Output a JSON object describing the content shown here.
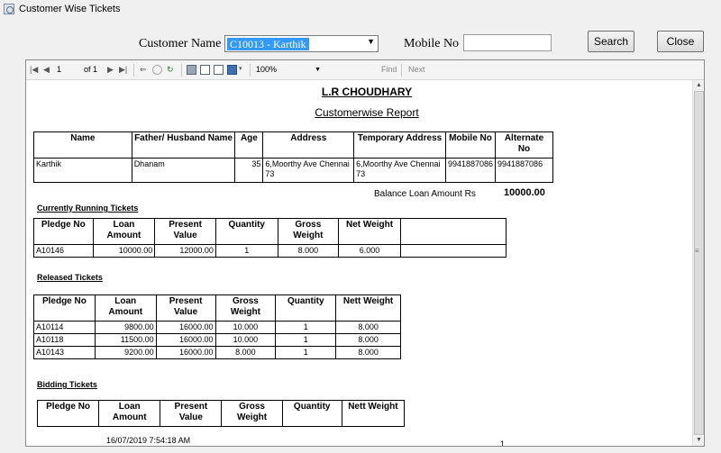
{
  "window": {
    "title": "Customer Wise Tickets"
  },
  "form": {
    "customer_name_label": "Customer Name",
    "customer_selected": "C10013  -  Karthik",
    "mobile_label": "Mobile No",
    "mobile_value": "",
    "search_label": "Search",
    "close_label": "Close"
  },
  "toolbar": {
    "page_current": "1",
    "page_of": "of 1",
    "zoom": "100%",
    "find_label": "Find",
    "next_label": "Next"
  },
  "report": {
    "company": "L.R CHOUDHARY",
    "subtitle": "Customerwise Report",
    "customer_table": {
      "headers": [
        "Name",
        "Father/ Husband Name",
        "Age",
        "Address",
        "Temporary Address",
        "Mobile No",
        "Alternate No"
      ],
      "row": [
        "Karthik",
        "Dhanam",
        "35",
        "6,Moorthy Ave Chennai 73",
        "6,Moorthy Ave Chennai 73",
        "9941887086",
        "9941887086"
      ]
    },
    "balance_label": "Balance Loan Amount Rs",
    "balance_value": "10000.00",
    "running": {
      "title": "Currently Running Tickets",
      "headers": [
        "Pledge No",
        "Loan Amount",
        "Present Value",
        "Quantity",
        "Gross Weight",
        "Net Weight",
        ""
      ],
      "rows": [
        [
          "A10146",
          "10000.00",
          "12000.00",
          "1",
          "8.000",
          "6.000",
          ""
        ]
      ]
    },
    "released": {
      "title": "Released Tickets",
      "headers": [
        "Pledge No",
        "Loan Amount",
        "Present Value",
        "Gross Weight",
        "Quantity",
        "Nett Weight"
      ],
      "rows": [
        [
          "A10114",
          "9800.00",
          "16000.00",
          "10.000",
          "1",
          "8.000"
        ],
        [
          "A10118",
          "11500.00",
          "16000.00",
          "10.000",
          "1",
          "8.000"
        ],
        [
          "A10143",
          "9200.00",
          "16000.00",
          "8.000",
          "1",
          "8.000"
        ]
      ]
    },
    "bidding": {
      "title": "Bidding Tickets",
      "headers": [
        "Pledge No",
        "Loan Amount",
        "Present Value",
        "Gross Weight",
        "Quantity",
        "Nett Weight"
      ]
    },
    "footer_date": "16/07/2019 7:54:18 AM",
    "footer_page": "1"
  }
}
